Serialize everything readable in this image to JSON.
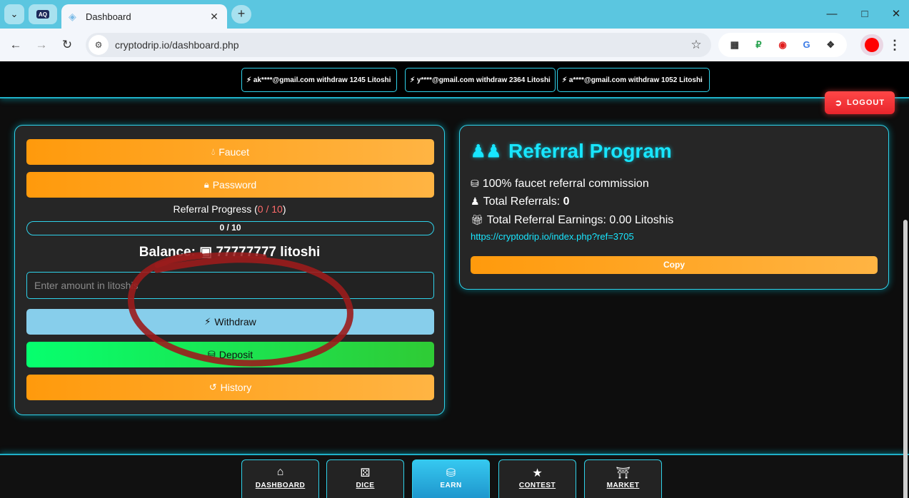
{
  "browser": {
    "tab_title": "Dashboard",
    "url": "cryptodrip.io/dashboard.php",
    "pinned_tab_badge": "AQ",
    "icons": {
      "tab_menu": "chevron-down-icon",
      "favicon": "diamond-icon",
      "close": "close-icon",
      "new_tab": "plus-icon",
      "back": "arrow-left-icon",
      "forward": "arrow-right-icon",
      "reload": "reload-icon",
      "site_info": "tune-icon",
      "bookmark": "star-icon",
      "extensions": [
        "qr-icon",
        "ruble-icon",
        "record-icon",
        "translate-icon",
        "puzzle-icon"
      ],
      "menu": "kebab-icon"
    }
  },
  "ticker": [
    "ak****@gmail.com withdraw 1245 Litoshi",
    "y****@gmail.com withdraw 2364 Litoshi",
    "a****@gmail.com withdraw 1052 Litoshi"
  ],
  "logout_label": "LOGOUT",
  "wallet": {
    "faucet_label": "Faucet",
    "password_label": "Password",
    "referral_progress_prefix": "Referral Progress (",
    "referral_progress_value": "0 / 10",
    "referral_progress_suffix": ")",
    "progress_text": "0 / 10",
    "progress_fraction": 0,
    "balance_label": "Balance:",
    "balance_value": "77777777 litoshi",
    "amount_placeholder": "Enter amount in litoshis",
    "withdraw_label": "Withdraw",
    "deposit_label": "Deposit",
    "history_label": "History"
  },
  "referral": {
    "title": "Referral Program",
    "commission": "100% faucet referral commission",
    "total_referrals_label": "Total Referrals:",
    "total_referrals_value": "0",
    "total_earnings": "Total Referral Earnings: 0.00 Litoshis",
    "link": "https://cryptodrip.io/index.php?ref=3705",
    "copy_label": "Copy"
  },
  "bottom_nav": [
    {
      "label": "DASHBOARD",
      "icon": "home-icon"
    },
    {
      "label": "DICE",
      "icon": "dice-icon"
    },
    {
      "label": "EARN",
      "icon": "coins-icon",
      "active": true
    },
    {
      "label": "CONTEST",
      "icon": "trophy-icon"
    },
    {
      "label": "MARKET",
      "icon": "store-icon"
    }
  ],
  "colors": {
    "accent_cyan": "#2fd2ea",
    "title_cyan": "#18e6ff",
    "orange": "#ff9a0c",
    "withdraw_blue": "#87ceeb",
    "deposit_green": "#06ff6e",
    "logout_red": "#ff4747",
    "annotation_red": "#9b1c1c"
  }
}
